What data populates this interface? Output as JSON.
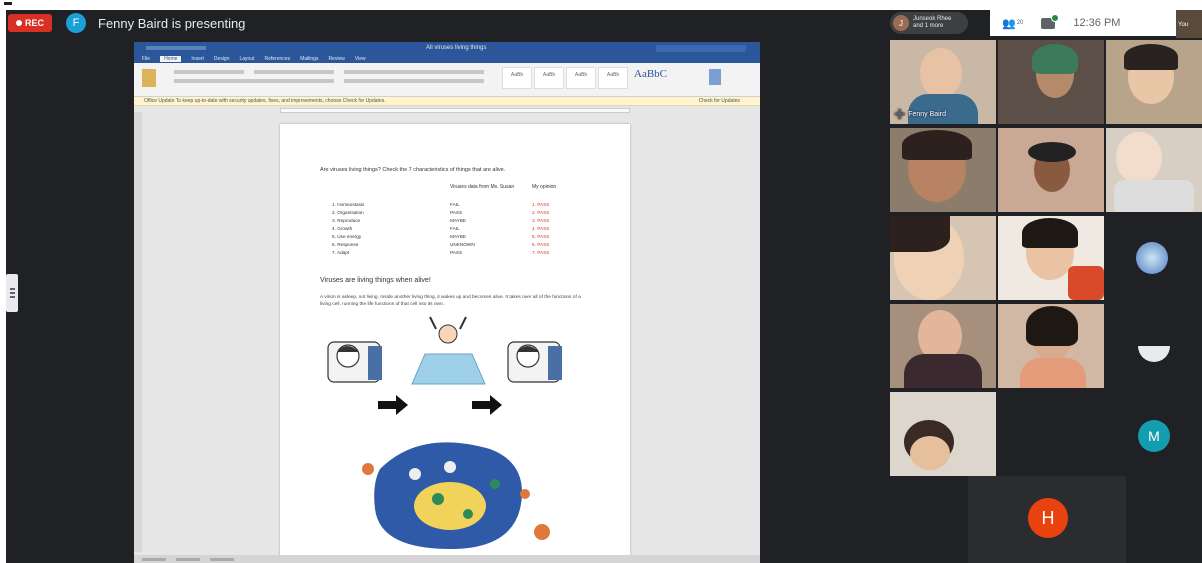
{
  "meeting": {
    "rec_label": "REC",
    "presenter_initial": "F",
    "presenter_text": "Fenny Baird is presenting"
  },
  "header": {
    "participant_initial": "J",
    "participant_text_1": "Junseok Rhee",
    "participant_text_2": "and 1 more",
    "people_count": "20",
    "time": "12:36 PM",
    "you_label": "You"
  },
  "document": {
    "window_title": "All viruses living things",
    "tabs": [
      "File",
      "Home",
      "Insert",
      "Design",
      "Layout",
      "References",
      "Mailings",
      "Review",
      "View"
    ],
    "notice_text": "Office Update  To keep up-to-date with security updates, fixes, and improvements, choose Check for Updates.",
    "notice_action": "Check for Updates",
    "style_sample": "AaBbC",
    "question": "Are viruses living things? Check the 7 characteristics of things that are alive.",
    "col_header_1": "Viruses data from Ms. Susan",
    "col_header_2": "My opinion",
    "rows": [
      {
        "name": "1.  Homeostasis",
        "data": "FAIL",
        "opinion": "1. PASS"
      },
      {
        "name": "2.  Organisation",
        "data": "PASS",
        "opinion": "2. PASS"
      },
      {
        "name": "3.  Reproduce",
        "data": "MAYBE",
        "opinion": "3. PASS"
      },
      {
        "name": "4.  Growth",
        "data": "FAIL",
        "opinion": "4. PASS"
      },
      {
        "name": "5.  Use energy",
        "data": "MAYBE",
        "opinion": "5. PASS"
      },
      {
        "name": "6.  Response",
        "data": "UNKNOWN",
        "opinion": "6. PASS"
      },
      {
        "name": "7.  Adapt",
        "data": "PASS",
        "opinion": "7. PASS"
      }
    ],
    "heading": "Viruses are living things when alive!",
    "paragraph": "A virion is asleep, not living. Inside another living thing, it wakes up and becomes alive. It takes over all of the functions of a living cell, running the life functions of that cell into its own."
  },
  "videos": [
    {
      "label": "Fenny Baird",
      "bg": "#c9b8a6",
      "face": "#e7c2a4"
    },
    {
      "label": "",
      "bg": "#5b4f47",
      "face": "#b58a6a"
    },
    {
      "label": "",
      "bg": "#b7a48b",
      "face": "#e9c6a6"
    },
    {
      "label": "",
      "bg": "#8c7c6c",
      "face": "#b78363"
    },
    {
      "label": "",
      "bg": "#c9a995",
      "face": "#8a5a40"
    },
    {
      "label": "",
      "bg": "#d8cfc4",
      "face": "#f2dccb"
    },
    {
      "label": "",
      "bg": "#d6c5b3",
      "face": "#efd1b6"
    },
    {
      "label": "",
      "bg": "#efe9e2",
      "face": "#e9c3a4"
    },
    {
      "label": "",
      "bg": "#a68f7d",
      "face": "#e1b69a"
    },
    {
      "label": "",
      "bg": "#d0b8a4",
      "face": "#d9ab8e"
    },
    {
      "label": "",
      "bg": "#dcd6cc",
      "face": "#3a2a24"
    }
  ],
  "avatar_tiles": {
    "m_initial": "M",
    "h_initial": "H"
  },
  "colors": {
    "rec": "#d93025",
    "word_blue": "#2b579a",
    "avatar_m": "#129eaf",
    "avatar_h": "#e8430f",
    "meet_bg": "#202124"
  }
}
